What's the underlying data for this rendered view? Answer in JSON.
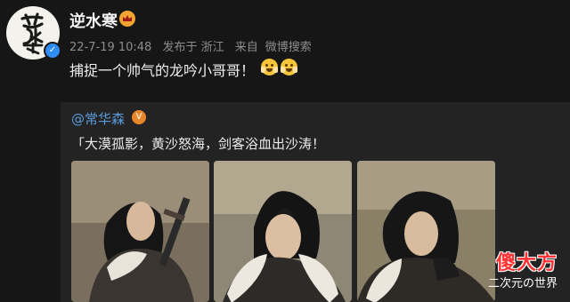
{
  "post": {
    "author": {
      "name": "逆水寒",
      "avatar_text": "逆水寒"
    },
    "meta": {
      "timestamp": "22-7-19 10:48",
      "location": "发布于 浙江",
      "source_prefix": "来自",
      "source": "微博搜索"
    },
    "text": "捕捉一个帅气的龙吟小哥哥！",
    "emojis": [
      "astonished-face",
      "astonished-face"
    ]
  },
  "repost": {
    "author": "@常华森",
    "text": "「大漠孤影，黄沙怒海，剑客浴血出沙涛！",
    "images": [
      {
        "name": "photo-1",
        "description_icon": "portrait"
      },
      {
        "name": "photo-2",
        "description_icon": "portrait"
      },
      {
        "name": "photo-3",
        "description_icon": "portrait"
      }
    ]
  },
  "watermark": {
    "main": "傻大方",
    "sub": "二次元の世界"
  },
  "colors": {
    "background": "#161616",
    "repost_background": "#232323",
    "link": "#5b9bdc",
    "verified": "#2f8cf0",
    "vip": "#f3a533",
    "watermark": "#ff3333"
  }
}
